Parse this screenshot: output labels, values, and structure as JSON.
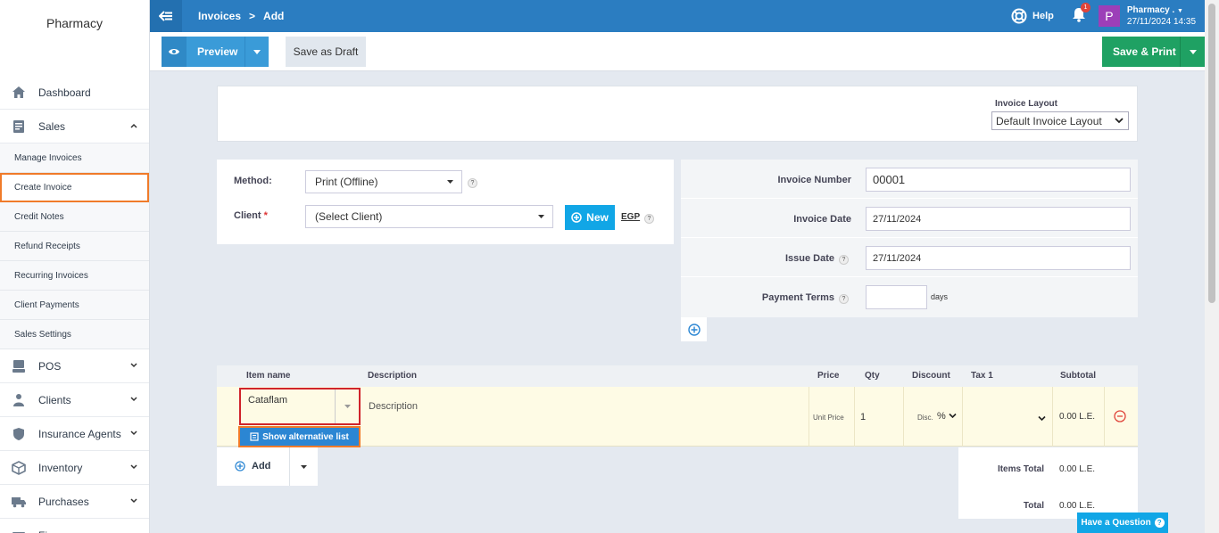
{
  "sidebar": {
    "brand": "Pharmacy",
    "items": [
      {
        "label": "Dashboard",
        "icon": "home-icon"
      },
      {
        "label": "Sales",
        "icon": "invoice-icon"
      }
    ],
    "sales_sub": [
      {
        "label": "Manage Invoices"
      },
      {
        "label": "Create Invoice",
        "active": true
      },
      {
        "label": "Credit Notes"
      },
      {
        "label": "Refund Receipts"
      },
      {
        "label": "Recurring Invoices"
      },
      {
        "label": "Client Payments"
      },
      {
        "label": "Sales Settings"
      }
    ],
    "more": [
      {
        "label": "POS",
        "icon": "pos-icon"
      },
      {
        "label": "Clients",
        "icon": "clients-icon"
      },
      {
        "label": "Insurance Agents",
        "icon": "shield-icon"
      },
      {
        "label": "Inventory",
        "icon": "box-icon"
      },
      {
        "label": "Purchases",
        "icon": "truck-icon"
      },
      {
        "label": "Fi",
        "icon": "finance-icon"
      }
    ]
  },
  "topbar": {
    "crumb1": "Invoices",
    "sep": ">",
    "crumb2": "Add",
    "help": "Help",
    "notif_count": "1",
    "avatar_letter": "P",
    "user_name": "Pharmacy .",
    "user_datetime": "27/11/2024 14:35"
  },
  "toolbar": {
    "preview": "Preview",
    "save_draft": "Save as Draft",
    "save_print": "Save & Print"
  },
  "layout": {
    "label": "Invoice Layout",
    "value": "Default Invoice Layout"
  },
  "method": {
    "method_label": "Method:",
    "method_value": "Print (Offline)",
    "client_label": "Client",
    "client_req": "*",
    "client_value": "(Select Client)",
    "new_label": "New",
    "currency": "EGP"
  },
  "info": {
    "number_label": "Invoice Number",
    "number_value": "00001",
    "date_label": "Invoice Date",
    "date_value": "27/11/2024",
    "issue_label": "Issue Date",
    "issue_value": "27/11/2024",
    "terms_label": "Payment Terms",
    "terms_value": "",
    "terms_unit": "days"
  },
  "table": {
    "headers": {
      "item": "Item name",
      "description": "Description",
      "price": "Price",
      "qty": "Qty",
      "discount": "Discount",
      "tax": "Tax 1",
      "subtotal": "Subtotal"
    },
    "row": {
      "item": "Cataflam",
      "alt_button": "Show alternative list",
      "description_placeholder": "Description",
      "unit_price_placeholder": "Unit Price",
      "qty": "1",
      "disc_placeholder": "Disc.",
      "disc_type": "%",
      "subtotal": "0.00 L.E."
    },
    "add_label": "Add"
  },
  "totals": {
    "items_total_label": "Items Total",
    "items_total_value": "0.00 L.E.",
    "total_label": "Total",
    "total_value": "0.00 L.E."
  },
  "have_question": "Have a Question",
  "colors": {
    "topbar": "#2b7dc1",
    "save_green": "#1fa163",
    "highlight_orange": "#f07b2a",
    "error_red": "#d0242b",
    "row_yellow": "#fefbe5"
  }
}
